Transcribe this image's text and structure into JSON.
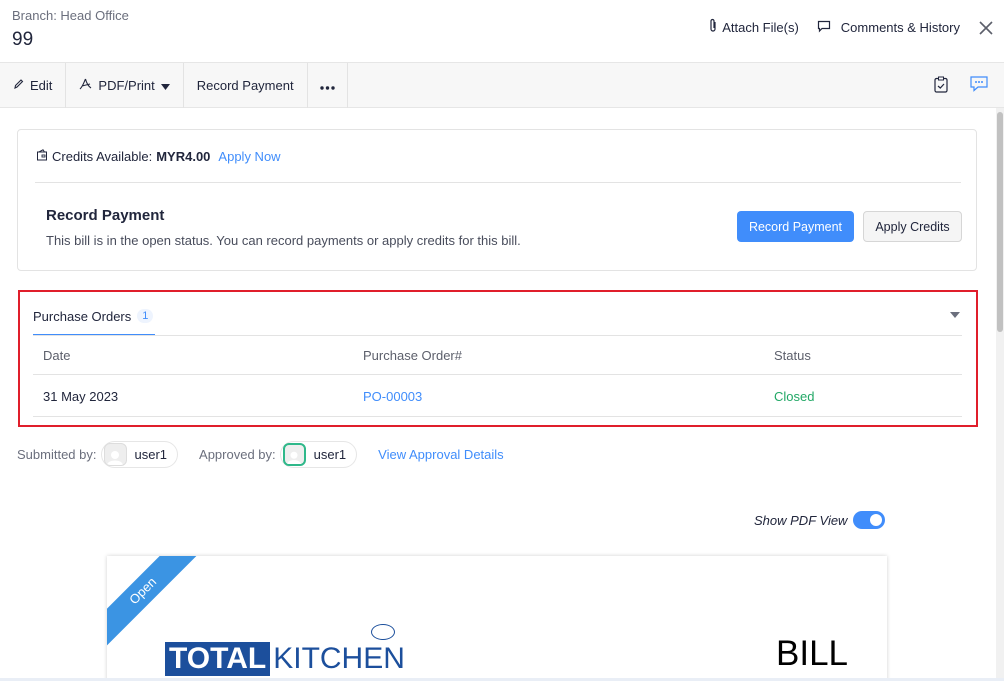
{
  "header": {
    "branch": "Branch: Head Office",
    "bill_number": "99",
    "attach_label": "Attach File(s)",
    "comments_label": "Comments & History"
  },
  "toolbar": {
    "edit_label": "Edit",
    "pdf_print_label": "PDF/Print",
    "record_payment_label": "Record Payment"
  },
  "credits": {
    "label": "Credits Available:",
    "amount": "MYR4.00",
    "apply_now": "Apply Now"
  },
  "record_payment": {
    "title": "Record Payment",
    "description": "This bill is in the open status. You can record payments or apply credits for this bill.",
    "primary_button": "Record Payment",
    "secondary_button": "Apply Credits"
  },
  "purchase_orders": {
    "tab_label": "Purchase Orders",
    "count": "1",
    "columns": [
      "Date",
      "Purchase Order#",
      "Status"
    ],
    "rows": [
      {
        "date": "31 May 2023",
        "po_number": "PO-00003",
        "status": "Closed"
      }
    ]
  },
  "approval": {
    "submitted_label": "Submitted by:",
    "submitted_user": "user1",
    "approved_label": "Approved by:",
    "approved_user": "user1",
    "view_details": "View Approval Details"
  },
  "pdf_view": {
    "toggle_label": "Show PDF View",
    "enabled": true,
    "ribbon_text": "Open",
    "logo_part1": "TOTAL",
    "logo_part2": "KITCHEN",
    "document_title": "BILL"
  },
  "colors": {
    "accent": "#408dfb",
    "status_closed": "#22a866",
    "highlight_border": "#e01e2b",
    "ribbon": "#3b94e3",
    "logo_blue": "#1c4f9c"
  }
}
